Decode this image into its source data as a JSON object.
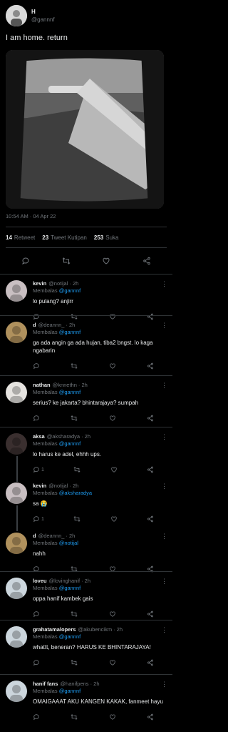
{
  "tweet": {
    "author_name": "H",
    "author_handle": "@gannnf",
    "text": "I am home. return",
    "timestamp": "10:54 AM · 04 Apr 22",
    "stats": [
      {
        "count": "14",
        "label": "Retweet"
      },
      {
        "count": "23",
        "label": "Tweet Kutipan"
      },
      {
        "count": "253",
        "label": "Suka"
      }
    ]
  },
  "replies": [
    {
      "name": "kevin",
      "handle": "@notijal",
      "time": "· 2h",
      "replying_label": "Membalas",
      "replying_to": "@gannnf",
      "text": "lo pulang? anjirr",
      "avatar_color": "#c9bfc2"
    },
    {
      "name": "d",
      "handle": "@deannn_",
      "time": "· 2h",
      "replying_label": "Membalas",
      "replying_to": "@gannnf",
      "text": "ga ada angin ga ada hujan, tiba2 bngst. lo kaga ngabarin",
      "avatar_color": "#b0915d"
    },
    {
      "name": "nathan",
      "handle": "@knnethn",
      "time": "· 2h",
      "replying_label": "Membalas",
      "replying_to": "@gannnf",
      "text": "serius? ke jakarta? bhintarajaya? sumpah",
      "avatar_color": "#e6e4e0"
    },
    {
      "name": "aksa",
      "handle": "@aksharadya",
      "time": "· 2h",
      "replying_label": "Membalas",
      "replying_to": "@gannnf",
      "text": "lo harus ke adel, ehhh ups.",
      "avatar_color": "#3a2f2f",
      "reply_count": "1"
    },
    {
      "name": "kevin",
      "handle": "@notijal",
      "time": "· 2h",
      "replying_label": "Membalas",
      "replying_to": "@aksharadya",
      "text": "sa 😭",
      "avatar_color": "#c9bfc2",
      "reply_count": "1"
    },
    {
      "name": "d",
      "handle": "@deannn_",
      "time": "· 2h",
      "replying_label": "Membalas",
      "replying_to": "@notijal",
      "text": "nahh",
      "avatar_color": "#b0915d"
    },
    {
      "name": "loveu",
      "handle": "@lovinghanif",
      "time": "· 2h",
      "replying_label": "Membalas",
      "replying_to": "@gannnf",
      "text": "oppa hanif kambek gais",
      "avatar_color": "#ccd6dd"
    },
    {
      "name": "grahatamalopers",
      "handle": "@akubencikm",
      "time": "· 2h",
      "replying_label": "Membalas",
      "replying_to": "@gannnf",
      "text": "whattt, beneran? HARUS KE BHINTARAJAYA!",
      "avatar_color": "#ccd6dd"
    },
    {
      "name": "hanif fans",
      "handle": "@hanifpens",
      "time": "· 2h",
      "replying_label": "Membalas",
      "replying_to": "@gannnf",
      "text": "OMAIGAAAT AKU KANGEN KAKAK, fanmeet hayu",
      "avatar_color": "#ccd6dd"
    }
  ],
  "icons": {
    "reply": "reply-icon",
    "retweet": "retweet-icon",
    "like": "heart-icon",
    "share": "share-icon",
    "more": "more-icon"
  },
  "colors": {
    "background": "#000000",
    "text": "#e7e9ea",
    "secondary": "#71767b",
    "link": "#1d9bf0",
    "divider": "#2f3336"
  }
}
